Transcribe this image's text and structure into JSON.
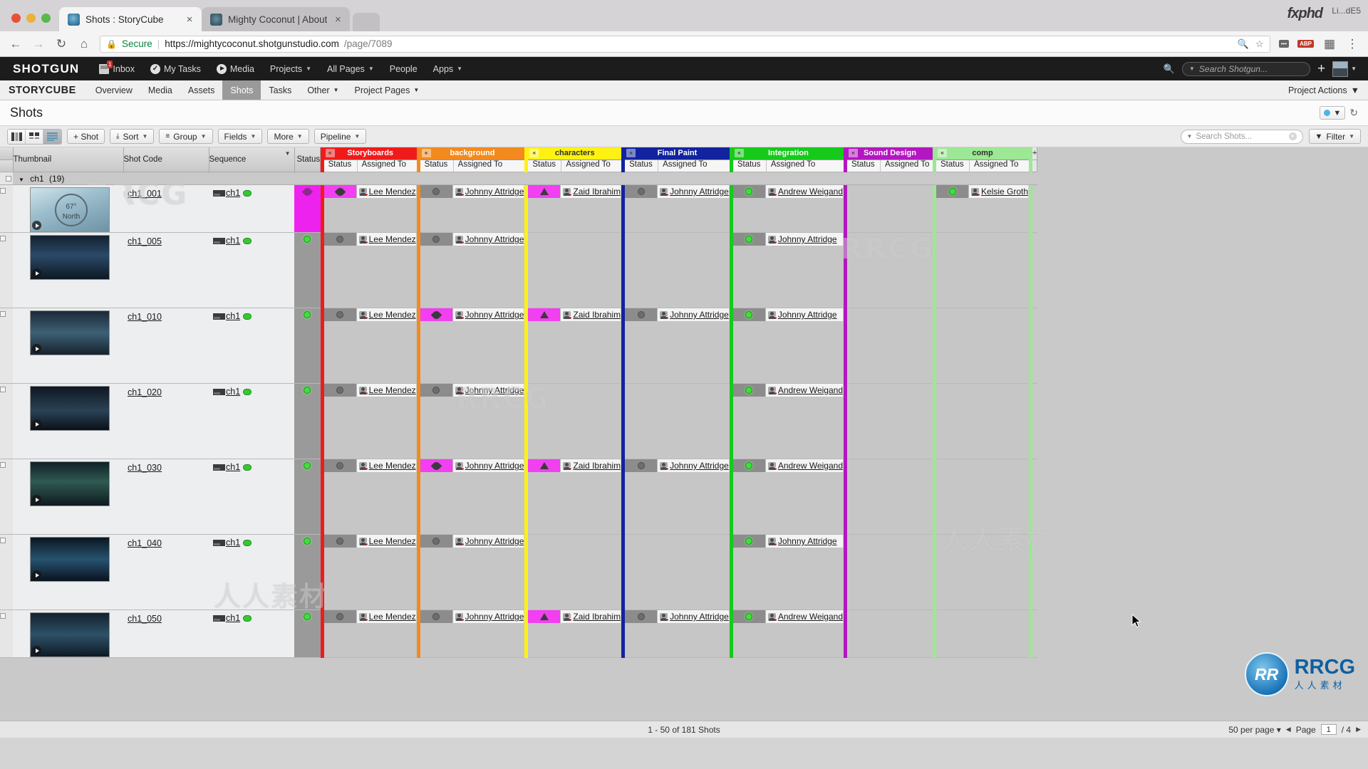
{
  "browser": {
    "tabs": [
      {
        "title": "Shots : StoryCube",
        "favicon": "shotgun-favicon",
        "active": true,
        "close": "×"
      },
      {
        "title": "Mighty Coconut | About",
        "favicon": "mightycoconut-favicon",
        "active": false,
        "close": "×"
      }
    ],
    "brand_overlay": "fxphd",
    "window_min_label": "Li...dE5",
    "url": {
      "secure_label": "Secure",
      "domain": "https://mightycoconut.shotgunstudio.com",
      "path": "/page/7089",
      "lock_icon": "lock-icon"
    },
    "nav_icons": {
      "back": "←",
      "forward": "→",
      "reload": "↻",
      "home": "⌂"
    },
    "omnibox_right": {
      "search_icon": "search-icon",
      "star_icon": "☆",
      "ext_badge": "•••",
      "abp_badge": "ABP",
      "apps_icon": "grid-icon",
      "menu_icon": "⋮"
    }
  },
  "shotgun_nav": {
    "logo": "SHOTGUN",
    "items": [
      {
        "label": "Inbox",
        "icon": "inbox-icon",
        "badge": "1",
        "caret": false
      },
      {
        "label": "My Tasks",
        "icon": "check-circle-icon",
        "caret": false
      },
      {
        "label": "Media",
        "icon": "play-circle-icon",
        "caret": false
      },
      {
        "label": "Projects",
        "icon": "",
        "caret": true
      },
      {
        "label": "All Pages",
        "icon": "",
        "caret": true
      },
      {
        "label": "People",
        "icon": "",
        "caret": false
      },
      {
        "label": "Apps",
        "icon": "",
        "caret": true
      }
    ],
    "search_placeholder": "Search Shotgun...",
    "plus_label": "+",
    "avatar": "user-avatar"
  },
  "project_bar": {
    "project": "STORYCUBE",
    "tabs": [
      {
        "label": "Overview",
        "active": false,
        "caret": false
      },
      {
        "label": "Media",
        "active": false,
        "caret": false
      },
      {
        "label": "Assets",
        "active": false,
        "caret": false
      },
      {
        "label": "Shots",
        "active": true,
        "caret": false
      },
      {
        "label": "Tasks",
        "active": false,
        "caret": false
      },
      {
        "label": "Other",
        "active": false,
        "caret": true
      },
      {
        "label": "Project Pages",
        "active": false,
        "caret": true
      }
    ],
    "actions_label": "Project Actions"
  },
  "page": {
    "title": "Shots",
    "refresh_icon": "refresh-icon"
  },
  "toolbar": {
    "view_modes": [
      {
        "name": "list-view",
        "active": false
      },
      {
        "name": "thumbnail-view",
        "active": false
      },
      {
        "name": "detail-view",
        "active": true
      }
    ],
    "buttons": [
      {
        "label": "+ Shot",
        "caret": false
      },
      {
        "label": "Sort",
        "caret": true,
        "icon": "sort-icon"
      },
      {
        "label": "Group",
        "caret": true,
        "icon": "group-icon"
      },
      {
        "label": "Fields",
        "caret": true
      },
      {
        "label": "More",
        "caret": true
      },
      {
        "label": "Pipeline",
        "caret": true
      }
    ],
    "search_placeholder": "Search Shots...",
    "filter_label": "Filter",
    "filter_icon": "funnel-icon"
  },
  "table": {
    "base_columns": [
      {
        "label": "Thumbnail",
        "sortable": false
      },
      {
        "label": "Shot Code",
        "sortable": false
      },
      {
        "label": "Sequence",
        "sortable": true
      },
      {
        "label": "Status",
        "sortable": false
      }
    ],
    "sub_headers": {
      "status": "Status",
      "assigned_to": "Assigned To"
    },
    "add_column_label": "+",
    "pipeline_steps": [
      {
        "name": "Storyboards",
        "color": "#ef1b1b",
        "text": "#ffffff"
      },
      {
        "name": "background",
        "color": "#f28a1e",
        "text": "#ffffff"
      },
      {
        "name": "characters",
        "color": "#fff212",
        "text": "#303030"
      },
      {
        "name": "Final Paint",
        "color": "#11239e",
        "text": "#ffffff"
      },
      {
        "name": "Integration",
        "color": "#16c91b",
        "text": "#ffffff"
      },
      {
        "name": "Sound Design",
        "color": "#b317c1",
        "text": "#ffffff"
      },
      {
        "name": "comp",
        "color": "#9ce894",
        "text": "#303030"
      }
    ],
    "group": {
      "label": "ch1",
      "count": "(19)"
    },
    "rows": [
      {
        "shot_code": "ch1_001",
        "sequence": "ch1",
        "status": "magenta",
        "tasks": [
          {
            "status": "magenta-chip",
            "assignee": "Lee Mendez"
          },
          {
            "status": "grey-dot",
            "assignee": "Johnny Attridge"
          },
          {
            "status": "magenta-triangle",
            "assignee": "Zaid Ibrahim"
          },
          {
            "status": "grey-dot",
            "assignee": "Johnny Attridge"
          },
          {
            "status": "green-dot",
            "assignee": "Andrew Weigand"
          },
          {
            "status": "",
            "assignee": ""
          },
          {
            "status": "green-dot",
            "assignee": "Kelsie Groth"
          }
        ]
      },
      {
        "shot_code": "ch1_005",
        "sequence": "ch1",
        "status": "green-dot",
        "tasks": [
          {
            "status": "grey-dot",
            "assignee": "Lee Mendez"
          },
          {
            "status": "grey-dot",
            "assignee": "Johnny Attridge"
          },
          {
            "status": "",
            "assignee": ""
          },
          {
            "status": "",
            "assignee": ""
          },
          {
            "status": "green-dot",
            "assignee": "Johnny Attridge"
          },
          {
            "status": "",
            "assignee": ""
          },
          {
            "status": "",
            "assignee": ""
          }
        ]
      },
      {
        "shot_code": "ch1_010",
        "sequence": "ch1",
        "status": "green-dot",
        "tasks": [
          {
            "status": "grey-dot",
            "assignee": "Lee Mendez"
          },
          {
            "status": "magenta-flower",
            "assignee": "Johnny Attridge"
          },
          {
            "status": "magenta-triangle",
            "assignee": "Zaid Ibrahim"
          },
          {
            "status": "grey-dot",
            "assignee": "Johnny Attridge"
          },
          {
            "status": "green-dot",
            "assignee": "Johnny Attridge"
          },
          {
            "status": "",
            "assignee": ""
          },
          {
            "status": "",
            "assignee": ""
          }
        ]
      },
      {
        "shot_code": "ch1_020",
        "sequence": "ch1",
        "status": "green-dot",
        "tasks": [
          {
            "status": "grey-dot",
            "assignee": "Lee Mendez"
          },
          {
            "status": "grey-dot",
            "assignee": "Johnny Attridge"
          },
          {
            "status": "",
            "assignee": ""
          },
          {
            "status": "",
            "assignee": ""
          },
          {
            "status": "green-dot",
            "assignee": "Andrew Weigand"
          },
          {
            "status": "",
            "assignee": ""
          },
          {
            "status": "",
            "assignee": ""
          }
        ]
      },
      {
        "shot_code": "ch1_030",
        "sequence": "ch1",
        "status": "green-dot",
        "tasks": [
          {
            "status": "grey-dot",
            "assignee": "Lee Mendez"
          },
          {
            "status": "magenta-flower",
            "assignee": "Johnny Attridge"
          },
          {
            "status": "magenta-triangle",
            "assignee": "Zaid Ibrahim"
          },
          {
            "status": "grey-dot",
            "assignee": "Johnny Attridge"
          },
          {
            "status": "green-dot",
            "assignee": "Andrew Weigand"
          },
          {
            "status": "",
            "assignee": ""
          },
          {
            "status": "",
            "assignee": ""
          }
        ]
      },
      {
        "shot_code": "ch1_040",
        "sequence": "ch1",
        "status": "green-dot",
        "tasks": [
          {
            "status": "grey-dot",
            "assignee": "Lee Mendez"
          },
          {
            "status": "grey-dot",
            "assignee": "Johnny Attridge"
          },
          {
            "status": "",
            "assignee": ""
          },
          {
            "status": "",
            "assignee": ""
          },
          {
            "status": "green-dot",
            "assignee": "Johnny Attridge"
          },
          {
            "status": "",
            "assignee": ""
          },
          {
            "status": "",
            "assignee": ""
          }
        ]
      },
      {
        "shot_code": "ch1_050",
        "sequence": "ch1",
        "status": "green-dot",
        "tasks": [
          {
            "status": "grey-dot",
            "assignee": "Lee Mendez"
          },
          {
            "status": "grey-dot",
            "assignee": "Johnny Attridge"
          },
          {
            "status": "magenta-triangle",
            "assignee": "Zaid Ibrahim"
          },
          {
            "status": "grey-dot",
            "assignee": "Johnny Attridge"
          },
          {
            "status": "green-dot",
            "assignee": "Andrew Weigand"
          },
          {
            "status": "",
            "assignee": ""
          },
          {
            "status": "",
            "assignee": ""
          }
        ]
      }
    ]
  },
  "footer": {
    "count_label": "1 - 50 of 181 Shots",
    "per_page": "50 per page",
    "page_word": "Page",
    "page_num": "1",
    "page_total": "/ 4",
    "prev_arrow": "◀",
    "next_arrow": "▶"
  },
  "watermarks": {
    "rrcg": "RRCG",
    "cn_text": "人人素材",
    "badge_initials": "RR",
    "badge_text": "RRCG",
    "badge_sub": "人人素材"
  }
}
